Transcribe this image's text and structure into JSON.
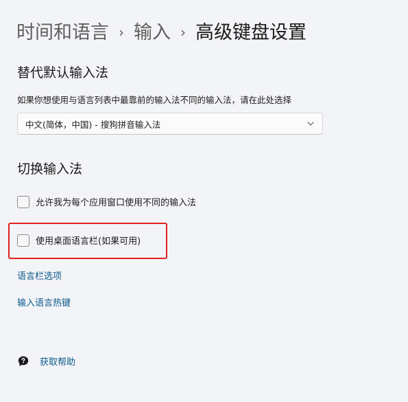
{
  "breadcrumb": {
    "items": [
      "时间和语言",
      "输入",
      "高级键盘设置"
    ],
    "separator": "›"
  },
  "override_section": {
    "title": "替代默认输入法",
    "description": "如果你想使用与语言列表中最靠前的输入法不同的输入法，请在此处选择",
    "selected_value": "中文(简体，中国) - 搜狗拼音输入法"
  },
  "switch_section": {
    "title": "切换输入法",
    "checkboxes": [
      {
        "label": "允许我为每个应用窗口使用不同的输入法",
        "checked": false
      },
      {
        "label": "使用桌面语言栏(如果可用)",
        "checked": false
      }
    ]
  },
  "links": {
    "language_bar_options": "语言栏选项",
    "input_language_hotkeys": "输入语言热键"
  },
  "help": {
    "label": "获取帮助",
    "icon": "help-chat-icon"
  },
  "colors": {
    "background": "#f3f4f7",
    "link": "#0b5a8a",
    "highlight": "#e0201b"
  }
}
